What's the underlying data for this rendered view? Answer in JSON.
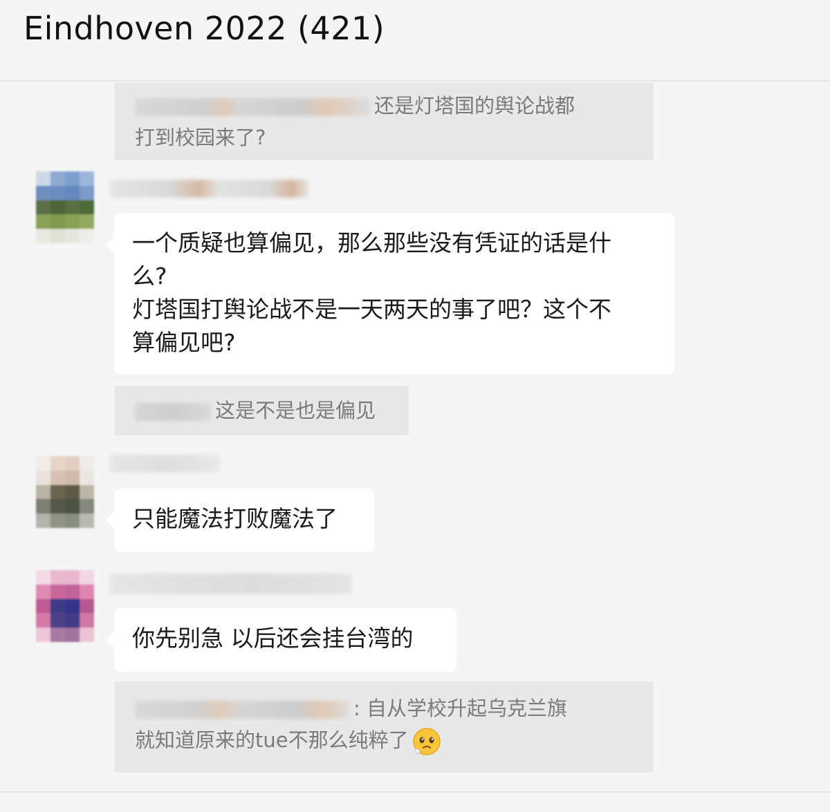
{
  "window": {
    "title": "Eindhoven 2022 (421)"
  },
  "messages": [
    {
      "type": "quote",
      "lines": [
        "还是灯塔国的舆论战都",
        "打到校园来了?"
      ]
    },
    {
      "type": "message",
      "lines": [
        "一个质疑也算偏见，那么那些没有凭证的话是什",
        "么?",
        "灯塔国打舆论战不是一天两天的事了吧？这个不",
        "算偏见吧?"
      ]
    },
    {
      "type": "quote",
      "lines": [
        "这是不是也是偏见"
      ]
    },
    {
      "type": "message",
      "lines": [
        "只能魔法打败魔法了"
      ]
    },
    {
      "type": "message",
      "lines": [
        "你先别急 以后还会挂台湾的"
      ]
    },
    {
      "type": "quote",
      "lines": [
        ": 自从学校升起乌克兰旗",
        "就知道原来的tue不那么纯粹了"
      ],
      "emoji": "pleading-face-icon"
    }
  ],
  "colors": {
    "background": "#f5f5f5",
    "bubble": "#ffffff",
    "quote": "#e8e8e8",
    "quote_text": "#7a7a7a"
  }
}
